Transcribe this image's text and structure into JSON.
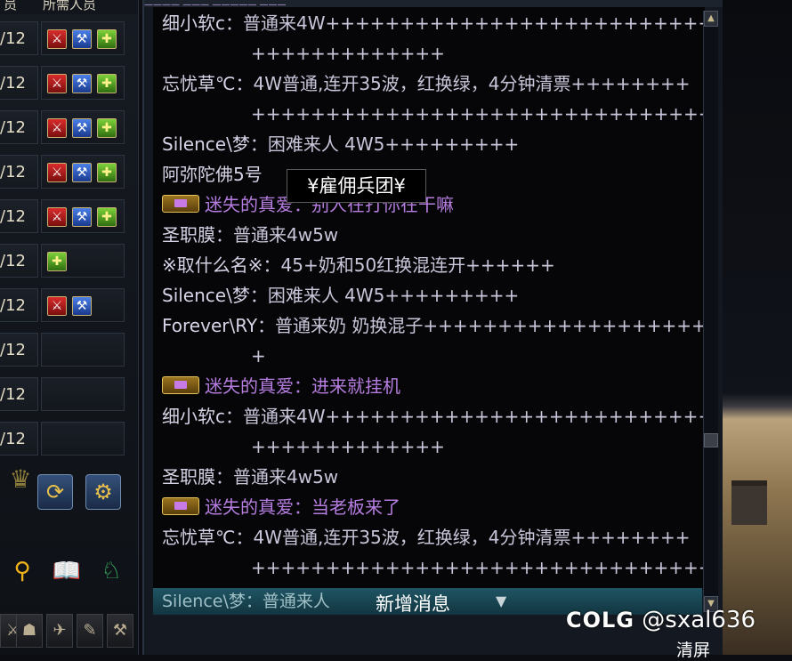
{
  "party_panel": {
    "header": [
      "员",
      "所需人员"
    ],
    "slots": [
      {
        "count": "/12",
        "icons": [
          "red",
          "blue",
          "green"
        ]
      },
      {
        "count": "/12",
        "icons": [
          "red",
          "blue",
          "green"
        ]
      },
      {
        "count": "/12",
        "icons": [
          "red",
          "blue",
          "green"
        ]
      },
      {
        "count": "/12",
        "icons": [
          "red",
          "blue",
          "green"
        ]
      },
      {
        "count": "/12",
        "icons": [
          "red",
          "blue",
          "green"
        ]
      },
      {
        "count": "/12",
        "icons": [
          "green"
        ]
      },
      {
        "count": "/12",
        "icons": [
          "red",
          "blue"
        ]
      },
      {
        "count": "/12",
        "icons": []
      },
      {
        "count": "/12",
        "icons": []
      },
      {
        "count": "/12",
        "icons": []
      }
    ],
    "refresh_icon": "refresh-icon",
    "settings_icon": "gear-icon",
    "tool_icons": [
      "map-pin-icon",
      "book-icon",
      "guild-icon"
    ]
  },
  "chat": {
    "top_strip": "———— ——— ————— ———",
    "lines": [
      {
        "name": "细小软c",
        "text": "：普通来4W+++++++++++++++++++++++++++++++++++++++",
        "vip": false
      },
      {
        "name": "",
        "text": "+++++++++++++",
        "vip": false,
        "wrap": true
      },
      {
        "name": "忘忧草℃",
        "text": "：4W普通,连开35波，红换绿，4分钟清票++++++++",
        "vip": false
      },
      {
        "name": "",
        "text": "+++++++++++++++++++++++++++++++++++",
        "vip": false,
        "wrap": true
      },
      {
        "name": "Silence\\梦",
        "text": "：困难来人 4W5+++++++++",
        "vip": false
      },
      {
        "name": "阿弥陀佛5号",
        "text": "",
        "vip": false
      },
      {
        "name": "迷失的真爱",
        "text": "：别人在打你在干嘛",
        "vip": true
      },
      {
        "name": "圣职膜",
        "text": "：普通来4w5w",
        "vip": false
      },
      {
        "name": "※取什么名※",
        "text": "：45+奶和50红换混连开++++++",
        "vip": false
      },
      {
        "name": "Silence\\梦",
        "text": "：困难来人 4W5+++++++++",
        "vip": false
      },
      {
        "name": "Forever\\RY",
        "text": "：普通来奶  奶换混子+++++++++++++++++++++",
        "vip": false
      },
      {
        "name": "",
        "text": "+",
        "vip": false,
        "wrap": true
      },
      {
        "name": "迷失的真爱",
        "text": "：进来就挂机",
        "vip": true
      },
      {
        "name": "细小软c",
        "text": "：普通来4W+++++++++++++++++++++++++++++++++++++++",
        "vip": false
      },
      {
        "name": "",
        "text": "+++++++++++++",
        "vip": false,
        "wrap": true
      },
      {
        "name": "圣职膜",
        "text": "：普通来4w5w",
        "vip": false
      },
      {
        "name": "迷失的真爱",
        "text": "：当老板来了",
        "vip": true
      },
      {
        "name": "忘忧草℃",
        "text": "：4W普通,连开35波，红换绿，4分钟清票++++++++",
        "vip": false
      },
      {
        "name": "",
        "text": "+++++++++++++++++++++++++++++++++++",
        "vip": false,
        "wrap": true
      }
    ],
    "tooltip": "¥雇佣兵团¥",
    "new_message_peek": "Silence\\梦：普通来人",
    "new_message_label": "新增消息",
    "new_message_arrow": "▼"
  },
  "watermark": {
    "brand": "COLG",
    "handle": "@sxal636"
  },
  "clear_label": "清屏"
}
